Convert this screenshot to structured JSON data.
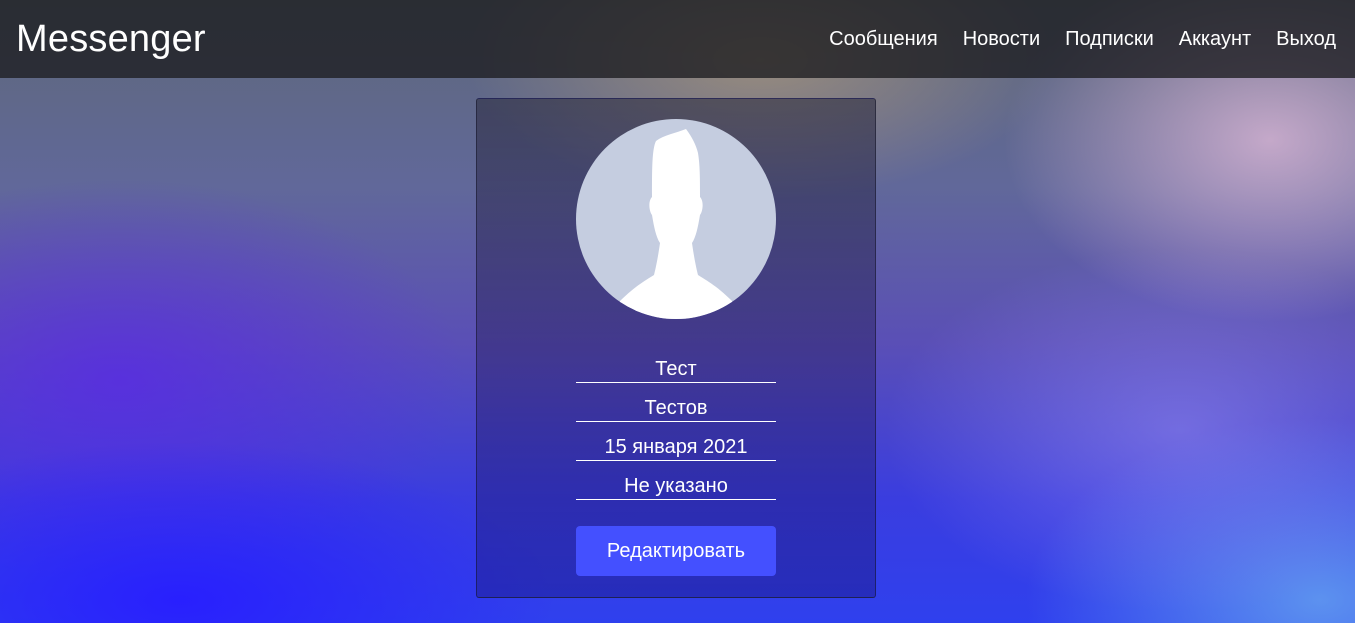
{
  "navbar": {
    "brand": "Messenger",
    "links": [
      {
        "label": "Сообщения"
      },
      {
        "label": "Новости"
      },
      {
        "label": "Подписки"
      },
      {
        "label": "Аккаунт"
      },
      {
        "label": "Выход"
      }
    ]
  },
  "profile": {
    "avatar_icon": "default-user-silhouette",
    "first_name": "Тест",
    "last_name": "Тестов",
    "birth_date": "15 января 2021",
    "extra_field": "Не указано",
    "edit_label": "Редактировать"
  },
  "colors": {
    "accent": "#4450ff",
    "avatar_bg": "#c5cde0",
    "navbar_bg": "#1c1c20"
  }
}
